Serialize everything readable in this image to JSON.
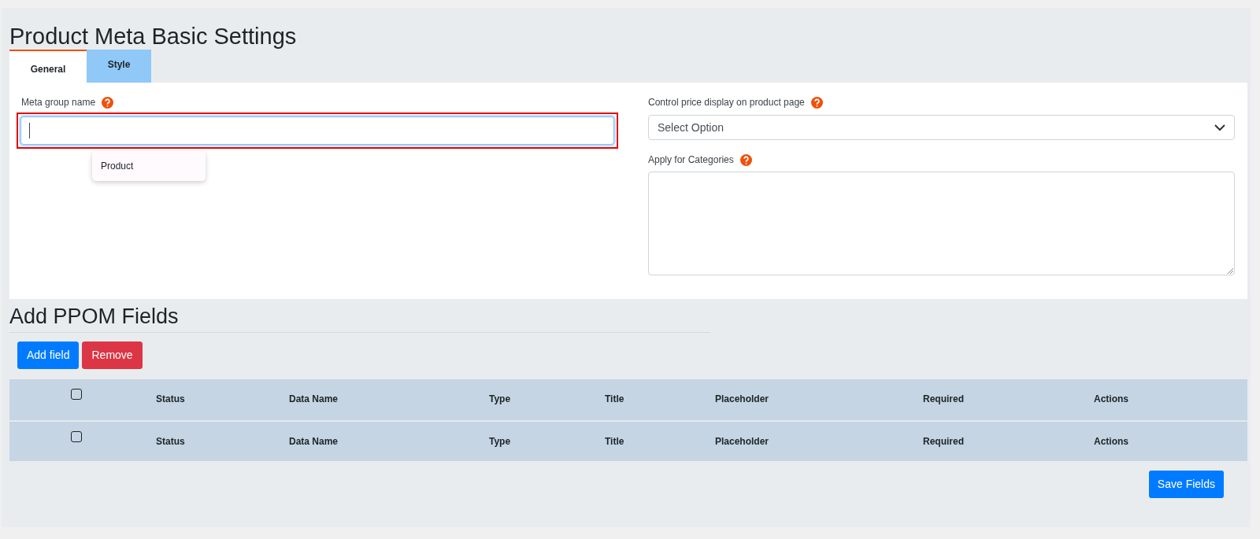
{
  "title": "Product Meta Basic Settings",
  "tabs": [
    {
      "label": "General",
      "selected": true
    },
    {
      "label": "Style",
      "selected": false
    }
  ],
  "meta_group_name": {
    "label": "Meta group name",
    "focused": true,
    "highlighted": true,
    "suggestions": [
      "Product"
    ]
  },
  "price_display": {
    "label": "Control price display on product page",
    "value": "Select Option"
  },
  "categories": {
    "label": "Apply for Categories"
  },
  "fields_section": {
    "title": "Add PPOM Fields",
    "buttons": [
      {
        "label": "Add field",
        "kind": "primary"
      },
      {
        "label": "Remove",
        "kind": "danger"
      }
    ]
  },
  "table": {
    "rows": [
      {
        "checked": false,
        "cells": [
          "Status",
          "Data Name",
          "Type",
          "Title",
          "Placeholder",
          "Required",
          "Actions"
        ]
      },
      {
        "checked": false,
        "cells": [
          "Status",
          "Data Name",
          "Type",
          "Title",
          "Placeholder",
          "Required",
          "Actions"
        ]
      }
    ]
  },
  "save_button": "Save Fields"
}
